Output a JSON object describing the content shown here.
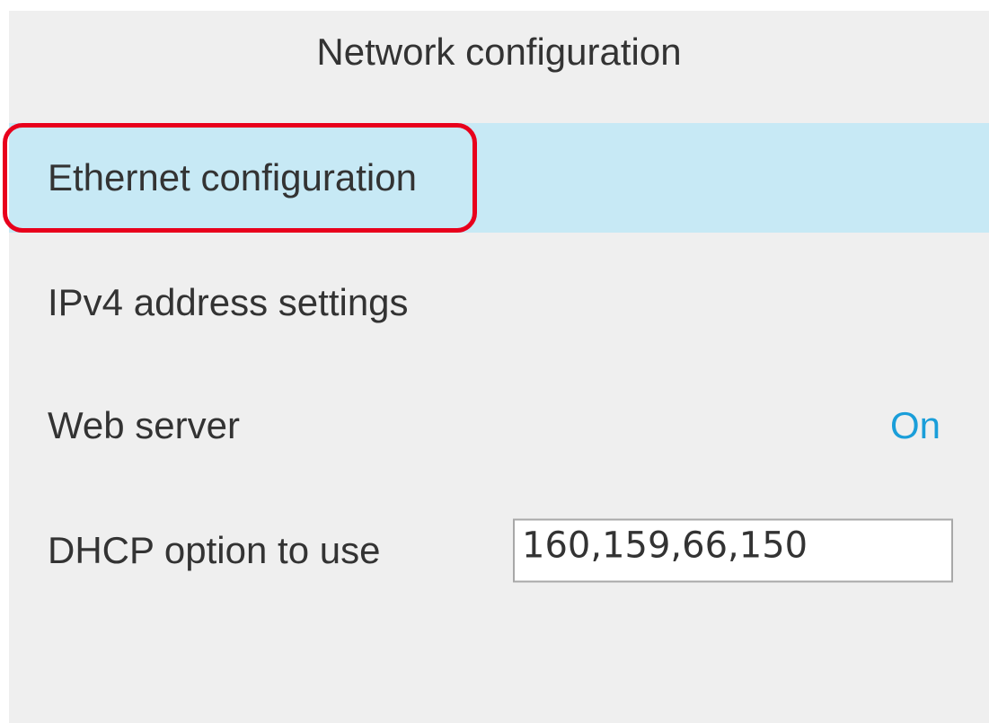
{
  "screen": {
    "title": "Network configuration"
  },
  "menu": {
    "ethernet": {
      "label": "Ethernet configuration"
    },
    "ipv4": {
      "label": "IPv4 address settings"
    },
    "web_server": {
      "label": "Web server",
      "value": "On"
    },
    "dhcp": {
      "label": "DHCP option to use",
      "value": "160,159,66,150"
    }
  },
  "colors": {
    "background": "#efefef",
    "selected_row": "#c7e9f5",
    "value_accent": "#1a9ed9",
    "highlight_outline": "#e8001c"
  }
}
